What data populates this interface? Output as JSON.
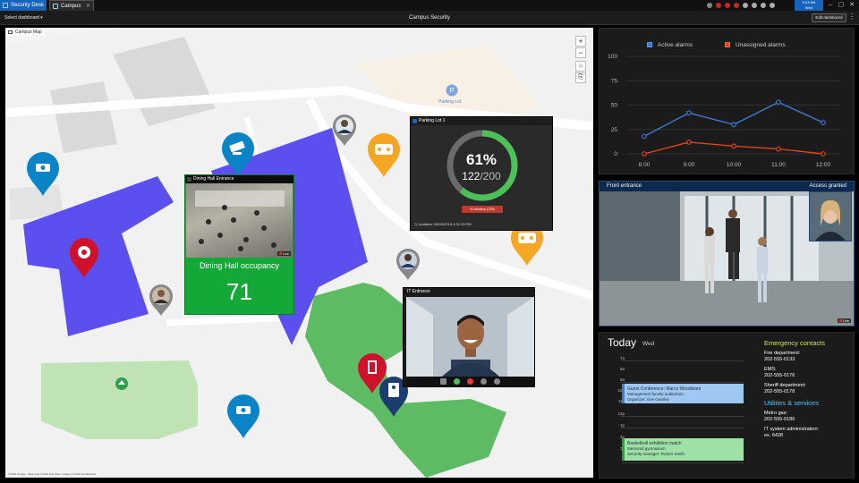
{
  "window": {
    "tabs": [
      {
        "label": "Security Desk"
      },
      {
        "label": "Campus Secu..."
      }
    ],
    "tab_close": "✕",
    "clock": {
      "time": "9:43 AM",
      "date": "Wed"
    }
  },
  "toolbar": {
    "select_dashboard": "Select dashboard ▾",
    "title": "Campus Security",
    "edit_dashboard": "Edit dashboard",
    "more": "⋮"
  },
  "map": {
    "label": "Campus Map",
    "zoom_in": "+",
    "zoom_out": "−",
    "layers_icon": "⌂",
    "other_icon": "⎘",
    "attribution": "©2018 Google – Map data ©2018 Tele Atlas, Imagery ©2018 TerraMetrics",
    "parking_lot_label": "Parking Lot",
    "dining": {
      "title": "Dining Hall Entrance",
      "label": "Dining Hall occupancy",
      "value": "71",
      "live": "Live"
    },
    "parking": {
      "title": "Parking Lot 1",
      "percent": "61%",
      "occupied": "122",
      "separator": "/",
      "total": "200",
      "fill_fraction": 0.61,
      "violators": "34 violators (13%)",
      "updated": "Updated: 04/03/2018 4:32:19 PM"
    },
    "it_entrance": {
      "title": "IT Entrance"
    }
  },
  "right": {
    "front_entrance": "Front entrance",
    "access_granted": "Access granted",
    "live": "Live"
  },
  "chart_data": {
    "type": "line",
    "categories": [
      "8:00",
      "9:00",
      "10:00",
      "11:00",
      "12:00"
    ],
    "series": [
      {
        "name": "Active alarms",
        "values": [
          18,
          42,
          30,
          53,
          32
        ],
        "color": "#3a7bd5"
      },
      {
        "name": "Unassigned alarms",
        "values": [
          0,
          12,
          8,
          5,
          0
        ],
        "color": "#e0431c"
      }
    ],
    "ylim": [
      0,
      100
    ],
    "yticks": [
      0,
      25,
      50,
      75,
      100
    ],
    "legend": "top",
    "grid": true
  },
  "calendar": {
    "today": "Today",
    "day": "Wed",
    "hours": [
      "7a",
      "8a",
      "9a",
      "10a",
      "11a",
      "12p",
      "1p",
      "2p",
      "3p"
    ],
    "events": [
      {
        "title": "Guest Conference: Marco Woodware",
        "line1": "Management faculty auditorium",
        "line2": "Organizer: Eve Gearley",
        "color": "#9ec8f2",
        "border": "#3a7bd5"
      },
      {
        "title": "Basketball exhibition match",
        "line1": "Memorial gymnasium",
        "line2": "Security manager: Robert Smith",
        "color": "#9fe0a6",
        "border": "#23a53a"
      }
    ]
  },
  "contacts": {
    "emergency_title": "Emergency contacts",
    "emergency": [
      {
        "name": "Fire department:",
        "phone": "202-555-0133"
      },
      {
        "name": "EMS:",
        "phone": "202-555-0176"
      },
      {
        "name": "Sheriff department:",
        "phone": "202-555-0178"
      }
    ],
    "utilities_title": "Utilities & services",
    "utilities": [
      {
        "name": "Metro gas:",
        "phone": "202-555-0186"
      },
      {
        "name": "IT system administration:",
        "phone": "ex. 6428"
      }
    ]
  },
  "colors": {
    "emergency_title": "#d4e157",
    "utilities_title": "#4fc3f7",
    "building_blue": "#5b4ff0",
    "green_area": "#5dbb63",
    "pin_blue": "#0a84c6",
    "pin_orange": "#f5a623",
    "pin_red": "#d0112b",
    "pin_navy": "#1c3d6e"
  }
}
